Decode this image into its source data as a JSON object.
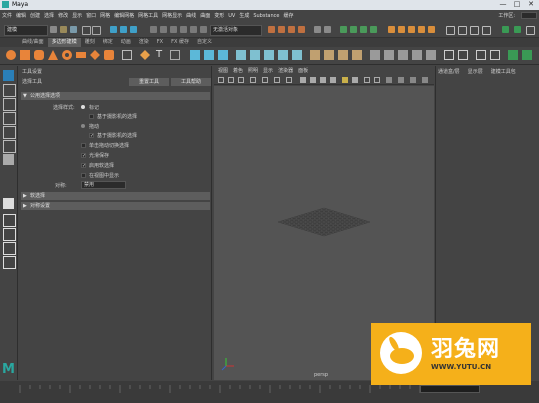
{
  "window": {
    "title": "Maya",
    "minimize": "—",
    "maximize": "□",
    "close": "✕"
  },
  "menubar": {
    "items": [
      "文件",
      "编辑",
      "创建",
      "选择",
      "修改",
      "显示",
      "窗口",
      "网格",
      "编辑网格",
      "网格工具",
      "网格显示",
      "曲线",
      "曲面",
      "变形",
      "UV",
      "生成",
      "Substance",
      "缓存"
    ],
    "workspace_label": "工作区:"
  },
  "statusline": {
    "mode_value": "建模",
    "snap_field": "无激活对象"
  },
  "shelf_tabs": [
    {
      "label": "曲线/曲面",
      "active": false
    },
    {
      "label": "多边形建模",
      "active": true
    },
    {
      "label": "雕刻",
      "active": false
    },
    {
      "label": "绑定",
      "active": false
    },
    {
      "label": "动画",
      "active": false
    },
    {
      "label": "渲染",
      "active": false
    },
    {
      "label": "FX",
      "active": false
    },
    {
      "label": "FX 缓存",
      "active": false
    },
    {
      "label": "自定义",
      "active": false
    }
  ],
  "tool_settings": {
    "title": "工具设置",
    "subtitle": "选择工具",
    "reset_button": "重置工具",
    "help_button": "工具帮助",
    "section_common": "公用选择选项",
    "select_mode_label": "选择样式:",
    "options": [
      {
        "label": "标记",
        "checked": false,
        "kind": "radio"
      },
      {
        "label": "基于摄影机的选择",
        "checked": false,
        "kind": "check"
      },
      {
        "label": "拖动",
        "checked": false,
        "kind": "radio"
      },
      {
        "label": "基于摄影机的选择",
        "checked": true,
        "kind": "check"
      },
      {
        "label": "单击拖动切换选择",
        "checked": false,
        "kind": "check"
      },
      {
        "label": "光滑保存",
        "checked": true,
        "kind": "check"
      },
      {
        "label": "启用软选择",
        "checked": true,
        "kind": "check"
      },
      {
        "label": "在视图中显示",
        "checked": false,
        "kind": "check"
      }
    ],
    "symmetry_label": "对称:",
    "symmetry_value": "禁用",
    "section_soft": "软选择",
    "section_symmetry": "对称设置"
  },
  "viewport": {
    "menu": [
      "视图",
      "着色",
      "照明",
      "显示",
      "渲染器",
      "面板"
    ],
    "camera_label": "persp"
  },
  "channel_box": {
    "tabs": [
      "通道盒/层",
      "显示层",
      "建模工具包"
    ]
  },
  "watermark": {
    "brand": "羽兔网",
    "url": "WWW.YUTU.CN"
  },
  "colors": {
    "accent": "#2aa7a0",
    "orange": "#e8843a",
    "watermark_bg": "#f5b01a"
  }
}
